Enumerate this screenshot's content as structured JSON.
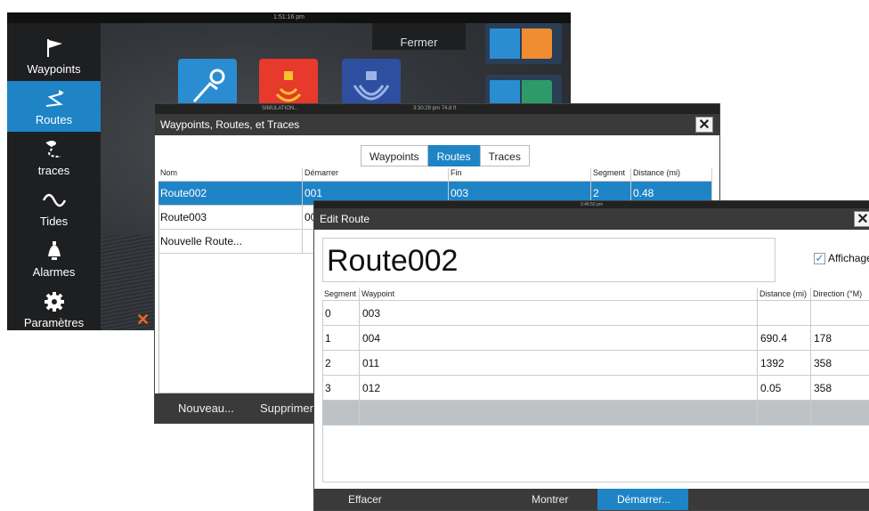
{
  "home": {
    "clock": "1:51:16 pm",
    "close_label": "Fermer",
    "sidebar": [
      {
        "label": "Waypoints",
        "icon": "flag-icon"
      },
      {
        "label": "Routes",
        "icon": "route-icon",
        "active": true
      },
      {
        "label": "traces",
        "icon": "trail-icon"
      },
      {
        "label": "Tides",
        "icon": "wave-icon"
      },
      {
        "label": "Alarmes",
        "icon": "bell-icon"
      },
      {
        "label": "Paramètres",
        "icon": "gear-icon"
      }
    ]
  },
  "routes_window": {
    "status_left": "SIMULATION...",
    "status_right": "3:30:29 pm  74.8 ft",
    "title": "Waypoints, Routes, et Traces",
    "tabs": [
      {
        "label": "Waypoints",
        "active": false
      },
      {
        "label": "Routes",
        "active": true
      },
      {
        "label": "Traces",
        "active": false
      }
    ],
    "columns": [
      "Nom",
      "Démarrer",
      "Fin",
      "Segment",
      "Distance (mi)"
    ],
    "rows": [
      {
        "name": "Route002",
        "start": "001",
        "end": "003",
        "segment": "2",
        "distance": "0.48",
        "selected": true
      },
      {
        "name": "Route003",
        "start": "00",
        "end": "",
        "segment": "",
        "distance": "",
        "selected": false
      },
      {
        "name": "Nouvelle Route...",
        "start": "",
        "end": "",
        "segment": "",
        "distance": "",
        "selected": false
      }
    ],
    "buttons": {
      "new": "Nouveau...",
      "delete": "Supprimer t"
    }
  },
  "edit_window": {
    "status": "2:46:50 pm",
    "title": "Edit Route",
    "route_name": "Route002",
    "display_label": "Affichage",
    "display_checked": true,
    "columns": [
      "Segment",
      "Waypoint",
      "Distance (mi)",
      "Direction (°M)"
    ],
    "rows": [
      {
        "segment": "0",
        "waypoint": "003",
        "distance": "",
        "direction": ""
      },
      {
        "segment": "1",
        "waypoint": "004",
        "distance": "690.4",
        "direction": "178"
      },
      {
        "segment": "2",
        "waypoint": "011",
        "distance": "1392",
        "direction": "358"
      },
      {
        "segment": "3",
        "waypoint": "012",
        "distance": "0.05",
        "direction": "358"
      }
    ],
    "buttons": {
      "clear": "Effacer",
      "show": "Montrer",
      "start": "Démarrer..."
    }
  },
  "colors": {
    "accent": "#1e84c6",
    "titlebar": "#3a3a3a",
    "close_x": "#f26522"
  }
}
